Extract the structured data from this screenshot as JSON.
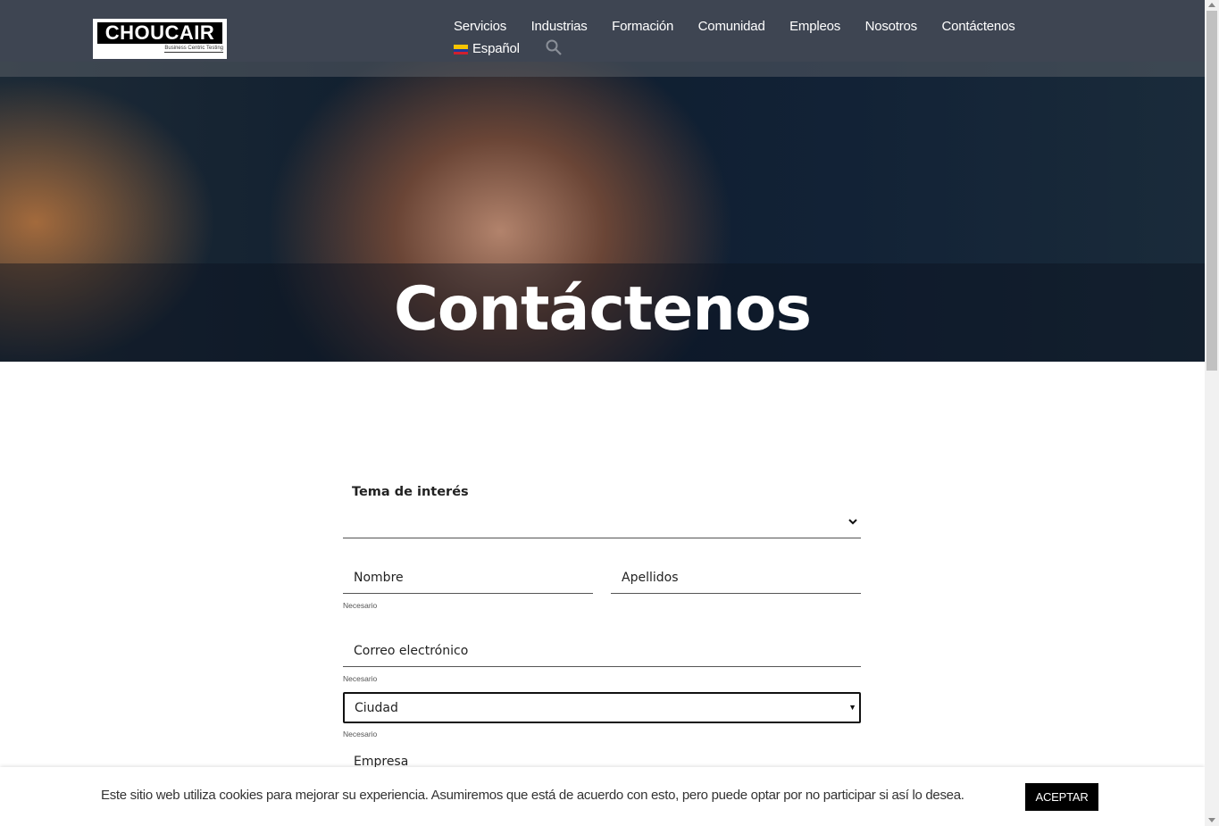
{
  "header": {
    "logo_text": "CHOUCAIR",
    "logo_tagline": "Business Centric Testing",
    "nav": [
      "Servicios",
      "Industrias",
      "Formación",
      "Comunidad",
      "Empleos",
      "Nosotros",
      "Contáctenos"
    ],
    "language": "Español",
    "search_icon": "search-icon"
  },
  "hero": {
    "title": "Contáctenos"
  },
  "form": {
    "tema_label": "Tema de interés",
    "nombre": "Nombre",
    "apellidos": "Apellidos",
    "nombre_required": "Necesario",
    "correo": "Correo electrónico",
    "correo_required": "Necesario",
    "ciudad": "Ciudad",
    "ciudad_required": "Necesario",
    "empresa": "Empresa"
  },
  "cookie": {
    "text": "Este sitio web utiliza cookies para mejorar su experiencia. Asumiremos que está de acuerdo con esto, pero puede optar por no participar si así lo desea.",
    "button": "ACEPTAR"
  }
}
